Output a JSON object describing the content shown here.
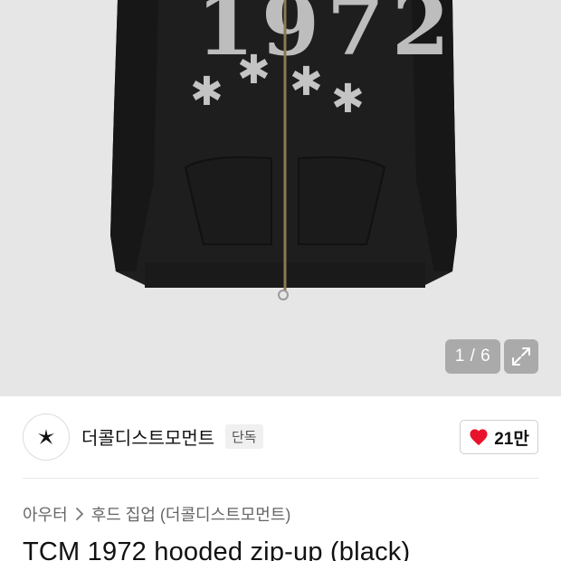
{
  "hero": {
    "image_alt": "TCM 1972 hooded zip-up (black)",
    "print_text": "1972",
    "pager": "1 / 6",
    "expand_icon": "expand-icon"
  },
  "brand": {
    "name": "더콜디스트모먼트",
    "badge": "단독",
    "logo_icon": "star-logo-icon"
  },
  "like": {
    "count": "21만",
    "icon": "heart-icon",
    "color": "#e8132b"
  },
  "breadcrumb": {
    "items": [
      "아우터",
      "후드 집업 (더콜디스트모먼트)"
    ],
    "separator_icon": "chevron-right-icon"
  },
  "product": {
    "title": "TCM 1972 hooded zip-up (black)"
  }
}
